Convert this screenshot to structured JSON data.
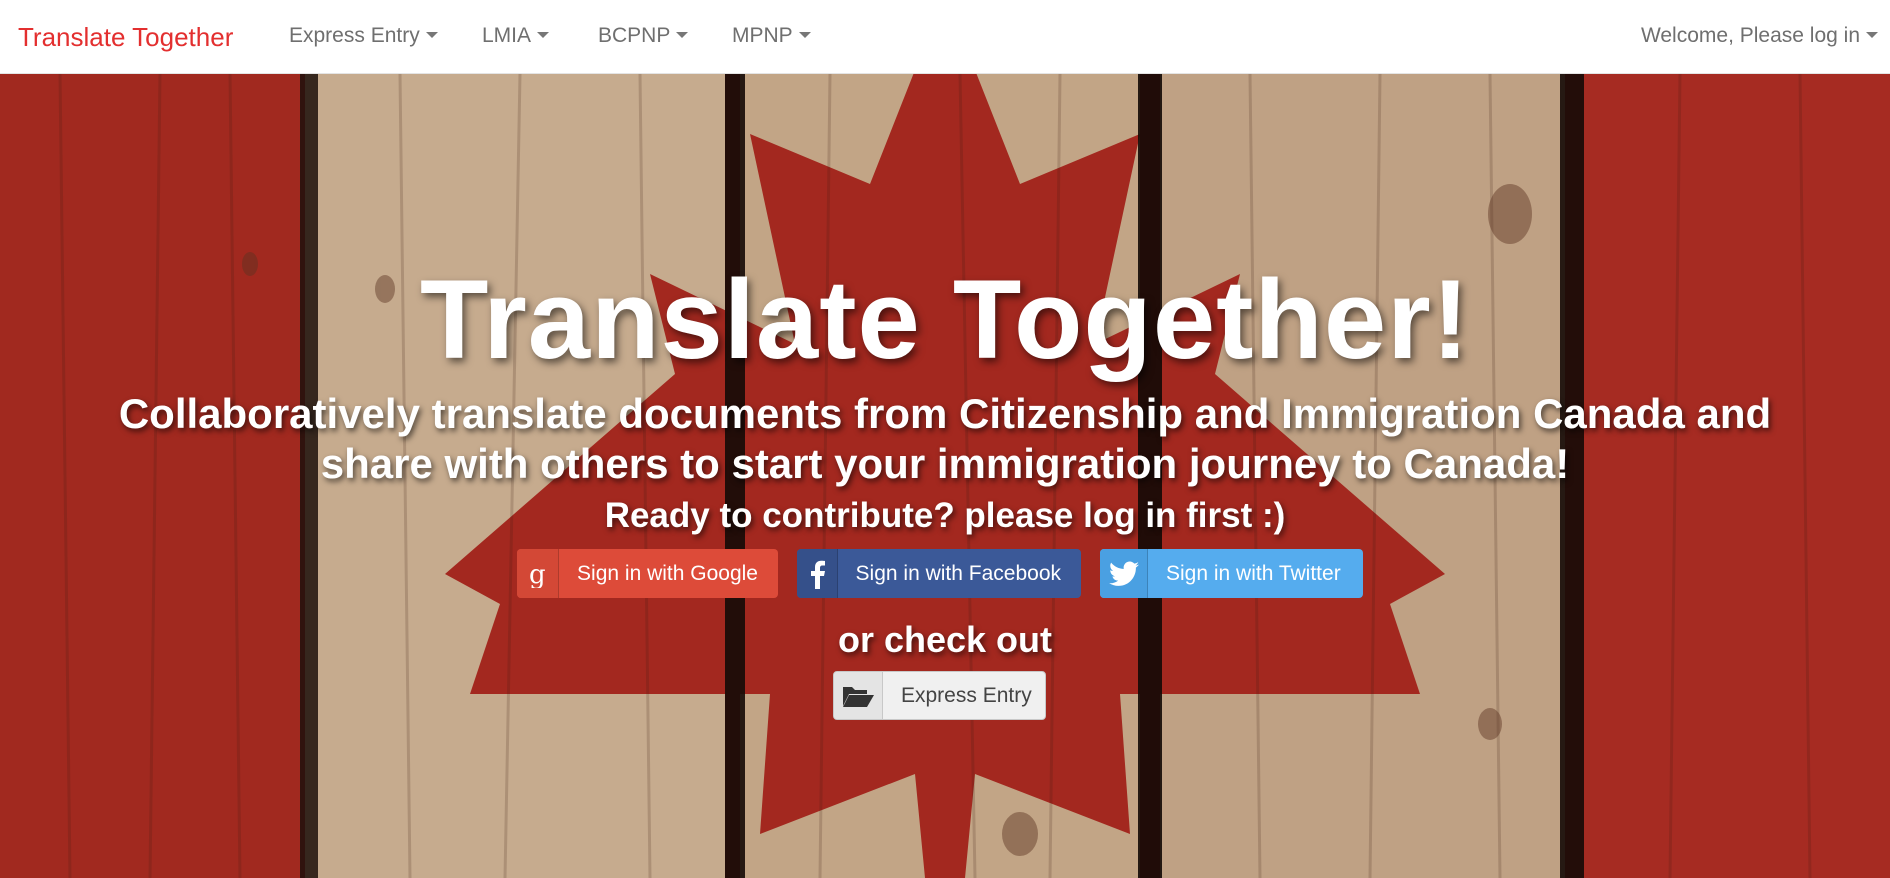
{
  "navbar": {
    "brand": "Translate Together",
    "items": [
      {
        "label": "Express Entry"
      },
      {
        "label": "LMIA"
      },
      {
        "label": "BCPNP"
      },
      {
        "label": "MPNP"
      }
    ],
    "welcome": "Welcome, Please log in"
  },
  "hero": {
    "title": "Translate Together!",
    "subtitle": "Collaboratively translate documents from Citizenship and Immigration Canada and share with others to start your immigration journey to Canada!",
    "ready_text": "Ready to contribute? please log in first :)",
    "signin_buttons": {
      "google": "Sign in with Google",
      "facebook": "Sign in with Facebook",
      "twitter": "Sign in with Twitter"
    },
    "or_text": "or check out",
    "express_button": "Express Entry"
  },
  "icons": {
    "google": "google-icon",
    "facebook": "facebook-icon",
    "twitter": "twitter-icon",
    "folder": "folder-open-icon",
    "caret": "caret-down-icon"
  },
  "colors": {
    "brand": "#e32f2f",
    "google": "#dd4b39",
    "facebook": "#3b5998",
    "twitter": "#55acee",
    "nav_text": "#6f6f6f"
  }
}
